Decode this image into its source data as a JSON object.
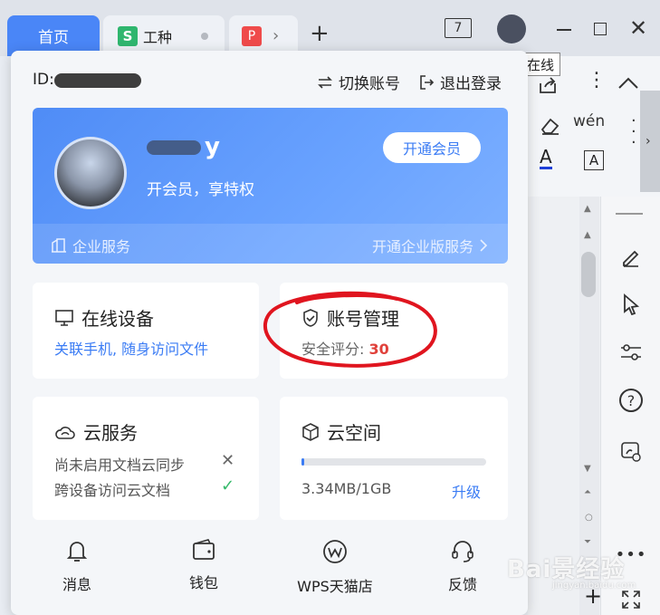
{
  "tabs": {
    "home": "首页",
    "doc_title": "工种",
    "window_count": "7"
  },
  "tooltip": {
    "text": "在线"
  },
  "panel": {
    "id_label": "ID:",
    "switch_account": "切换账号",
    "logout": "退出登录",
    "member": {
      "name_visible": "y",
      "subtitle": "开会员，享特权",
      "open_button": "开通会员",
      "enterprise": "企业服务",
      "enterprise_link": "开通企业版服务"
    },
    "devices": {
      "title": "在线设备",
      "link": "关联手机, 随身访问文件"
    },
    "account": {
      "title": "账号管理",
      "security_label": "安全评分:",
      "security_score": "30"
    },
    "cloud": {
      "title": "云服务",
      "row1": "尚未启用文档云同步",
      "row2": "跨设备访问云文档"
    },
    "space": {
      "title": "云空间",
      "usage": "3.34MB/1GB",
      "used_fraction": 0.0033,
      "upgrade": "升级"
    },
    "quick_actions": {
      "message": "消息",
      "wallet": "钱包",
      "store": "WPS天猫店",
      "feedback": "反馈"
    }
  },
  "toolbar": {
    "pinyin": "wén"
  },
  "watermark": {
    "main": "Bai景经验",
    "sub": "jingyan.baidu.com"
  },
  "colors": {
    "accent": "#3b7cf4",
    "score_red": "#e0413b",
    "annotation_red": "#e0151f",
    "check_green": "#35b96a"
  }
}
